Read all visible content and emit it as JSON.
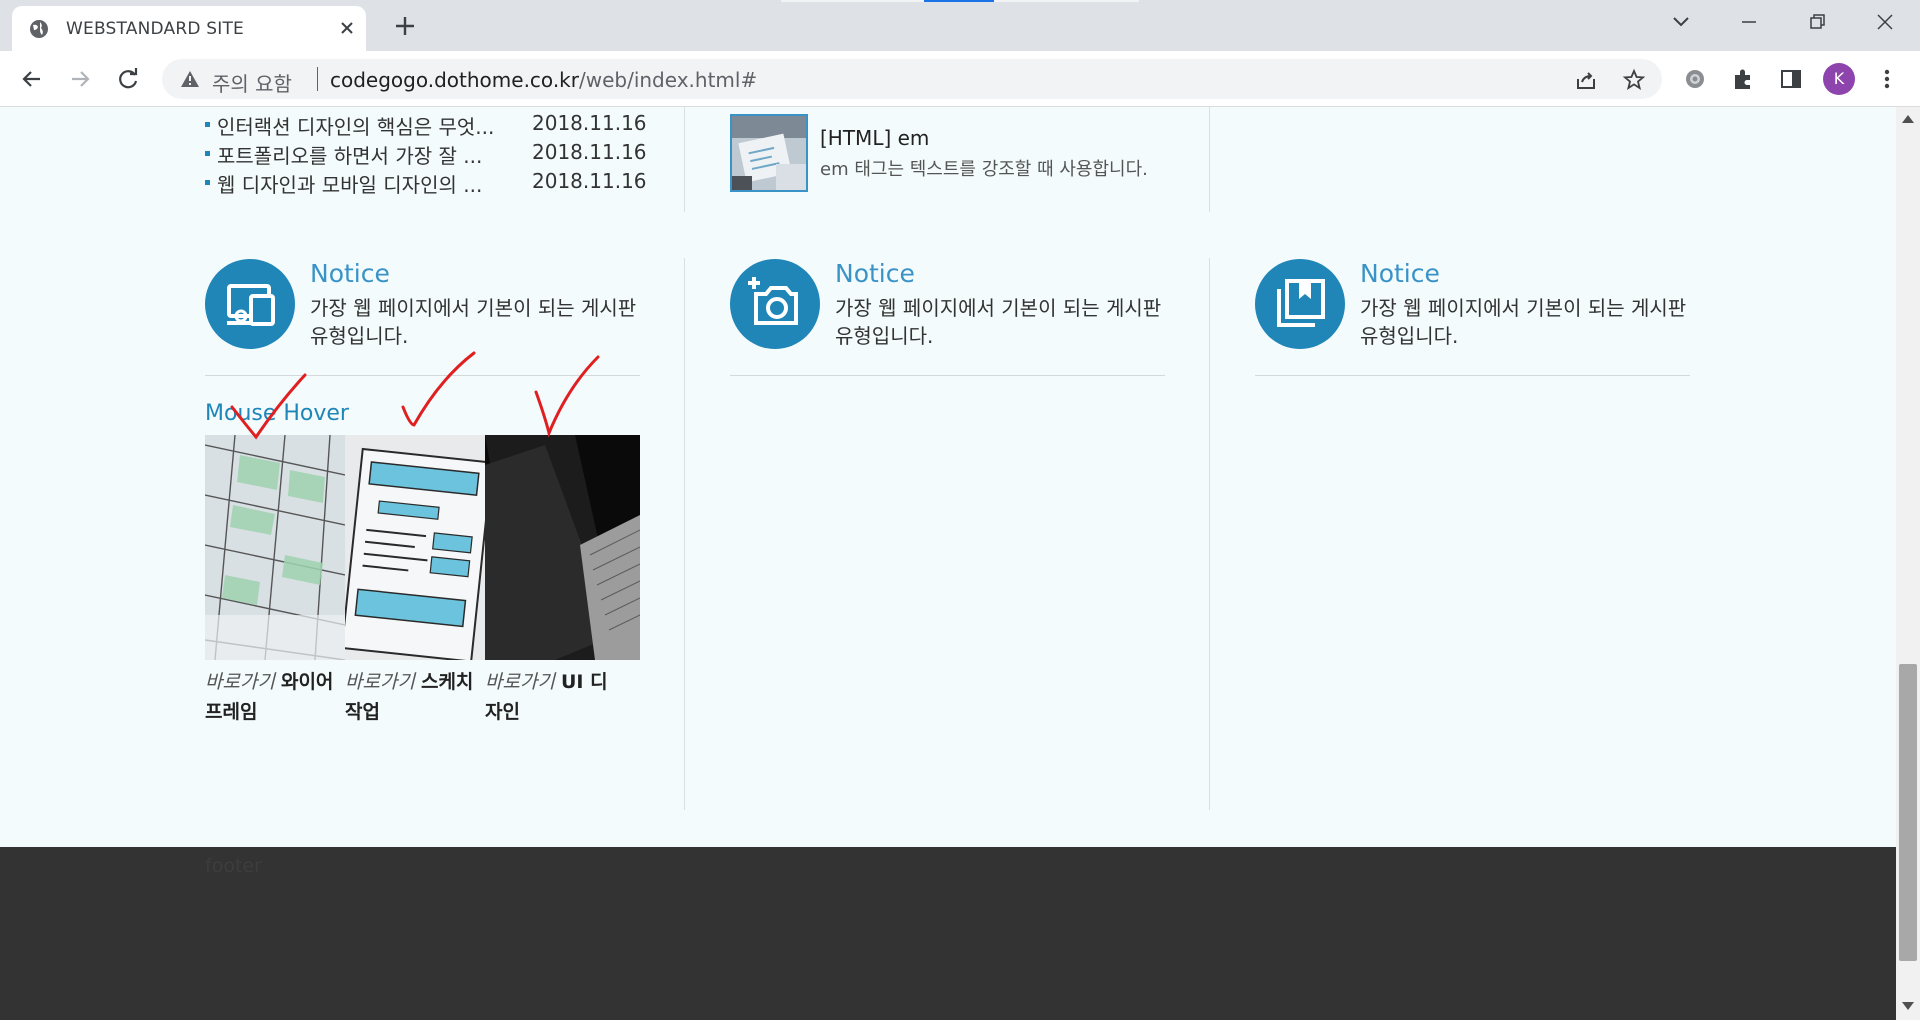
{
  "browser": {
    "tab_title": "WEBSTANDARD SITE",
    "security_label": "주의 요함",
    "url_host": "codegogo.dothome.co.kr",
    "url_path": "/web/index.html#",
    "profile_initial": "K"
  },
  "news": [
    {
      "title": "인터랙션 디자인의 핵심은 무엇...",
      "date": "2018.11.16"
    },
    {
      "title": "포트폴리오를 하면서 가장 잘 ...",
      "date": "2018.11.16"
    },
    {
      "title": "웹 디자인과 모바일 디자인의 ...",
      "date": "2018.11.16"
    }
  ],
  "post": {
    "title": "[HTML] em",
    "desc": "em 태그는 텍스트를 강조할 때 사용합니다."
  },
  "notices": [
    {
      "title": "Notice",
      "desc": "가장 웹 페이지에서 기본이 되는 게시판 유형입니다.",
      "icon": "devices-icon"
    },
    {
      "title": "Notice",
      "desc": "가장 웹 페이지에서 기본이 되는 게시판 유형입니다.",
      "icon": "camera-add-icon"
    },
    {
      "title": "Notice",
      "desc": "가장 웹 페이지에서 기본이 되는 게시판 유형입니다.",
      "icon": "bookmark-library-icon"
    }
  ],
  "mouse_hover": {
    "title": "Mouse Hover",
    "items": [
      {
        "go": "바로가기",
        "name": "와이어 프레임"
      },
      {
        "go": "바로가기",
        "name": "스케치 작업"
      },
      {
        "go": "바로가기",
        "name": "UI 디자인"
      }
    ]
  },
  "footer": {
    "label": "footer"
  },
  "colors": {
    "accent": "#1f86b7",
    "footer_bg": "#333333",
    "page_bg": "#f3fbfd",
    "annotation": "#e02020"
  }
}
